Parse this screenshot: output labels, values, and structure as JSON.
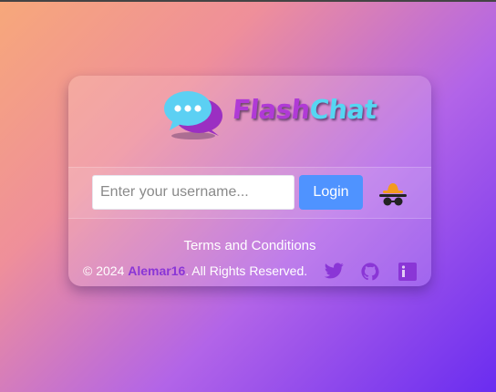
{
  "app": {
    "logo_part1": "Flash",
    "logo_part2": "Chat"
  },
  "login": {
    "username_placeholder": "Enter your username...",
    "username_value": "",
    "login_label": "Login"
  },
  "footer": {
    "terms_label": "Terms and Conditions",
    "copyright_prefix": "© 2024 ",
    "owner": "Alemar16",
    "copyright_suffix": ". All Rights Reserved.",
    "social_icons": [
      "twitter-icon",
      "github-icon",
      "linkedin-icon"
    ]
  },
  "colors": {
    "accent": "#8a36d6",
    "login_button": "#4f93ff",
    "logo_flash": "#b03ad6",
    "logo_chat": "#56d6f2"
  }
}
